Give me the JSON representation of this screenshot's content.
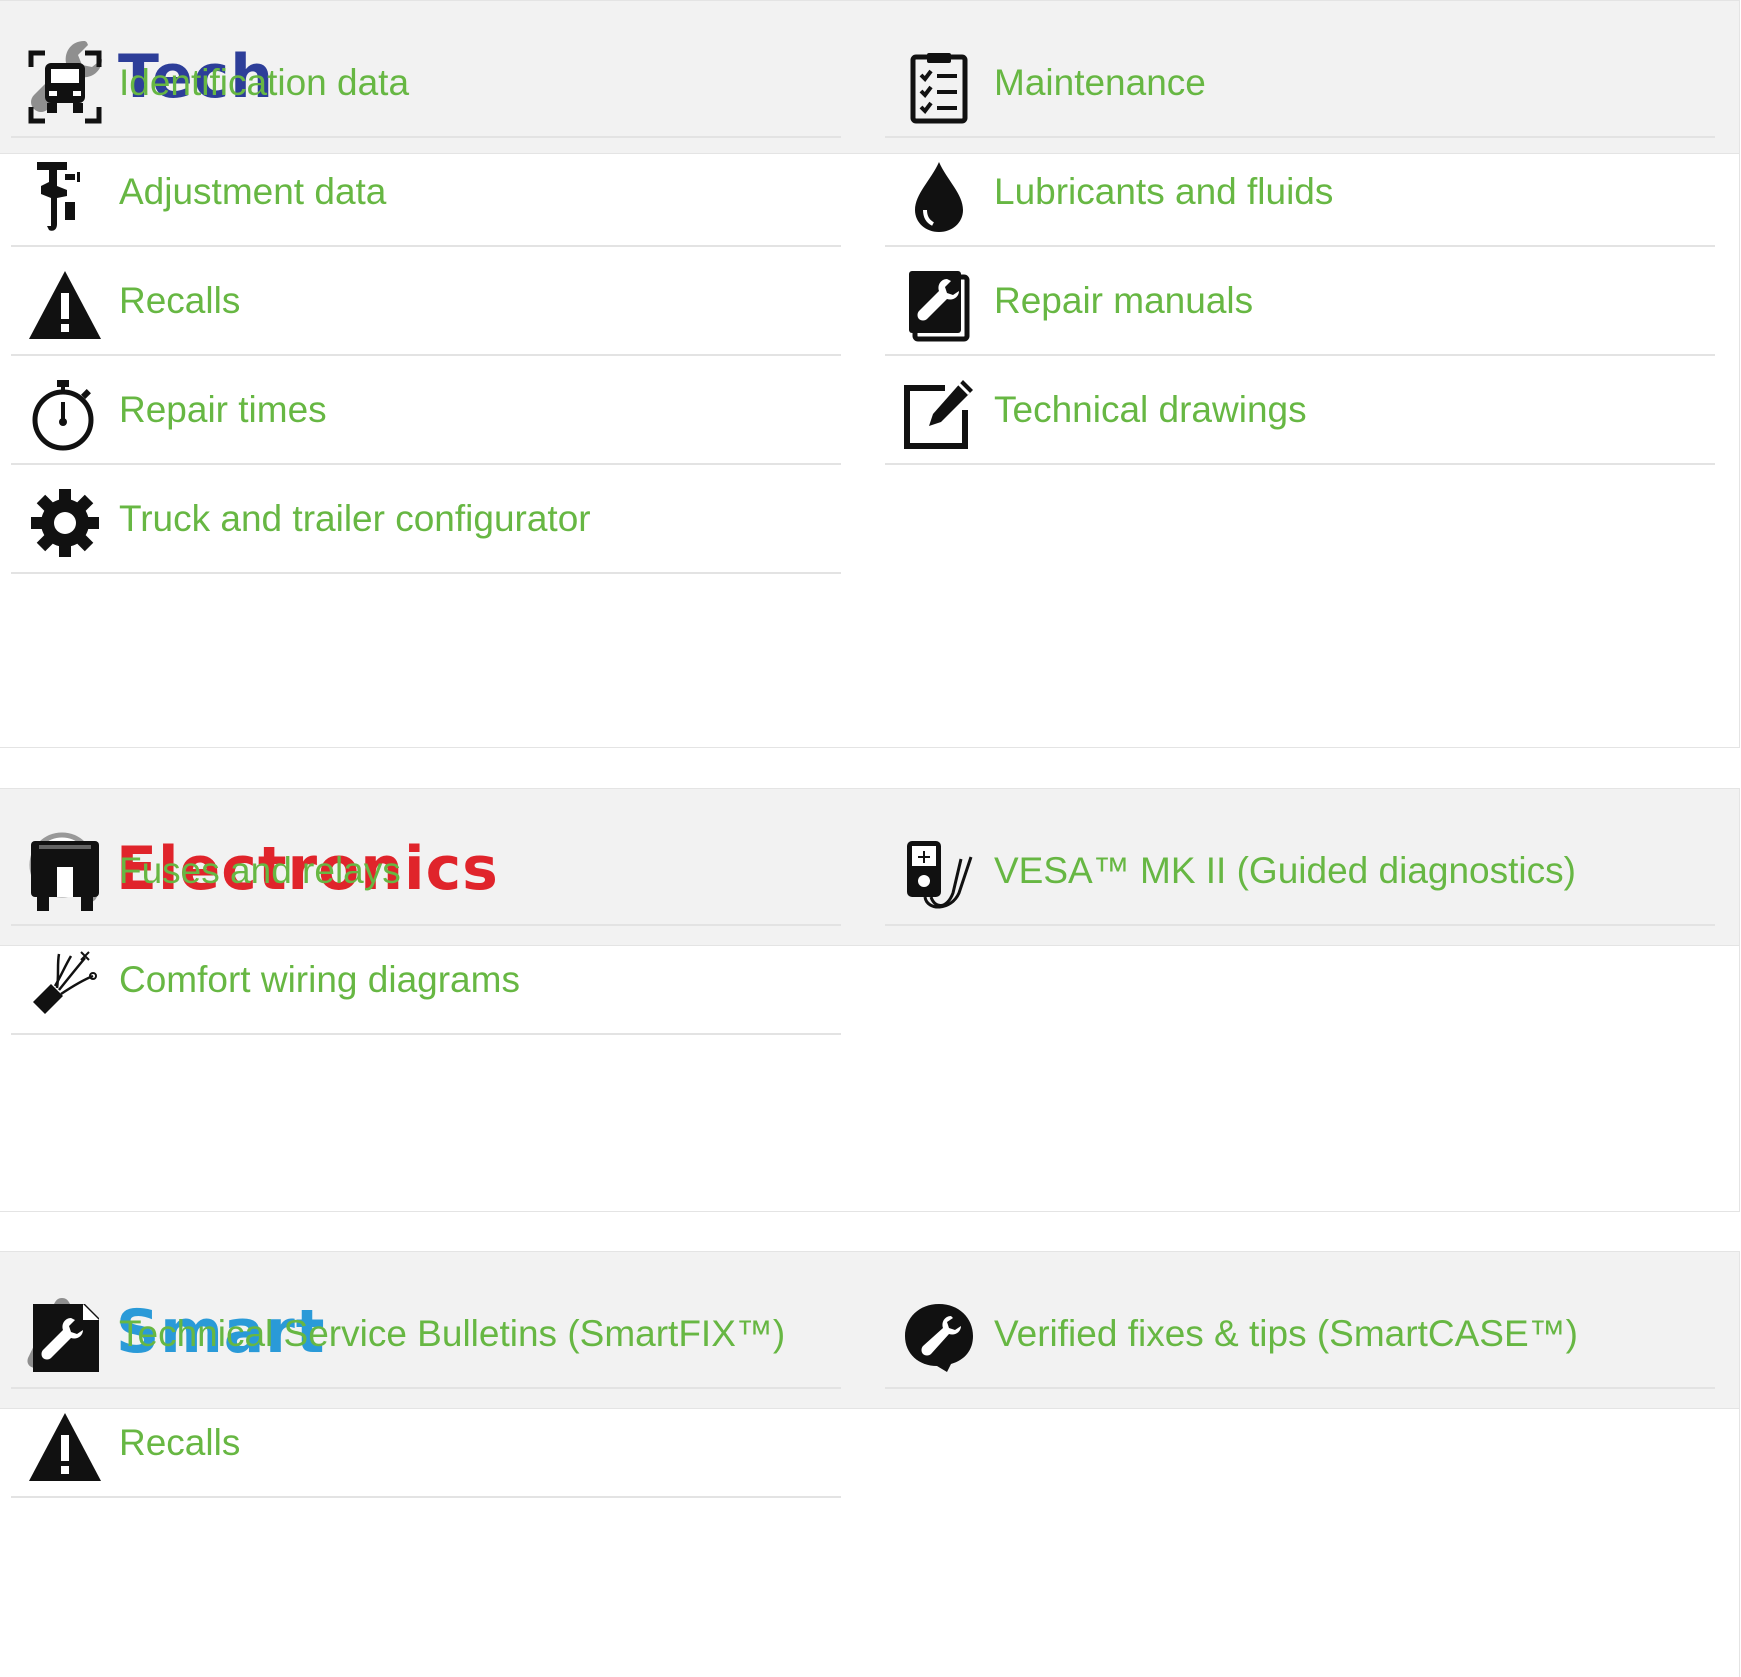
{
  "colors": {
    "link": "#67b743",
    "tech_title": "#2d3e99",
    "electronics_title": "#e0242b",
    "smart_title": "#2a9ad8",
    "header_bg": "#f2f2f2",
    "icon_dark": "#111111",
    "icon_grey": "#8a8a8a"
  },
  "sections": {
    "tech": {
      "title": "Tech",
      "icon": "wrench-icon",
      "left": [
        {
          "label": "Identification data",
          "icon": "truck-scan-icon"
        },
        {
          "label": "Adjustment data",
          "icon": "caliper-icon"
        },
        {
          "label": "Recalls",
          "icon": "warning-icon"
        },
        {
          "label": "Repair times",
          "icon": "stopwatch-icon"
        },
        {
          "label": "Truck and trailer configurator",
          "icon": "gear-icon"
        }
      ],
      "right": [
        {
          "label": "Maintenance",
          "icon": "checklist-icon"
        },
        {
          "label": "Lubricants and fluids",
          "icon": "drop-icon"
        },
        {
          "label": "Repair manuals",
          "icon": "repair-manual-icon"
        },
        {
          "label": "Technical drawings",
          "icon": "edit-icon"
        }
      ]
    },
    "electronics": {
      "title": "Electronics",
      "icon": "diagnostics-icon",
      "left": [
        {
          "label": "Fuses and relays",
          "icon": "fuse-icon"
        },
        {
          "label": "Comfort wiring diagrams",
          "icon": "wiring-icon"
        }
      ],
      "right": [
        {
          "label": "VESA™ MK II (Guided diagnostics)",
          "icon": "multimeter-icon"
        }
      ]
    },
    "smart": {
      "title": "Smart",
      "icon": "info-triangle-icon",
      "left": [
        {
          "label": "Technical Service Bulletins (SmartFIX™)",
          "icon": "bulletin-icon"
        },
        {
          "label": "Recalls",
          "icon": "warning-icon"
        }
      ],
      "right": [
        {
          "label": "Verified fixes & tips (SmartCASE™)",
          "icon": "chat-wrench-icon"
        }
      ]
    }
  }
}
